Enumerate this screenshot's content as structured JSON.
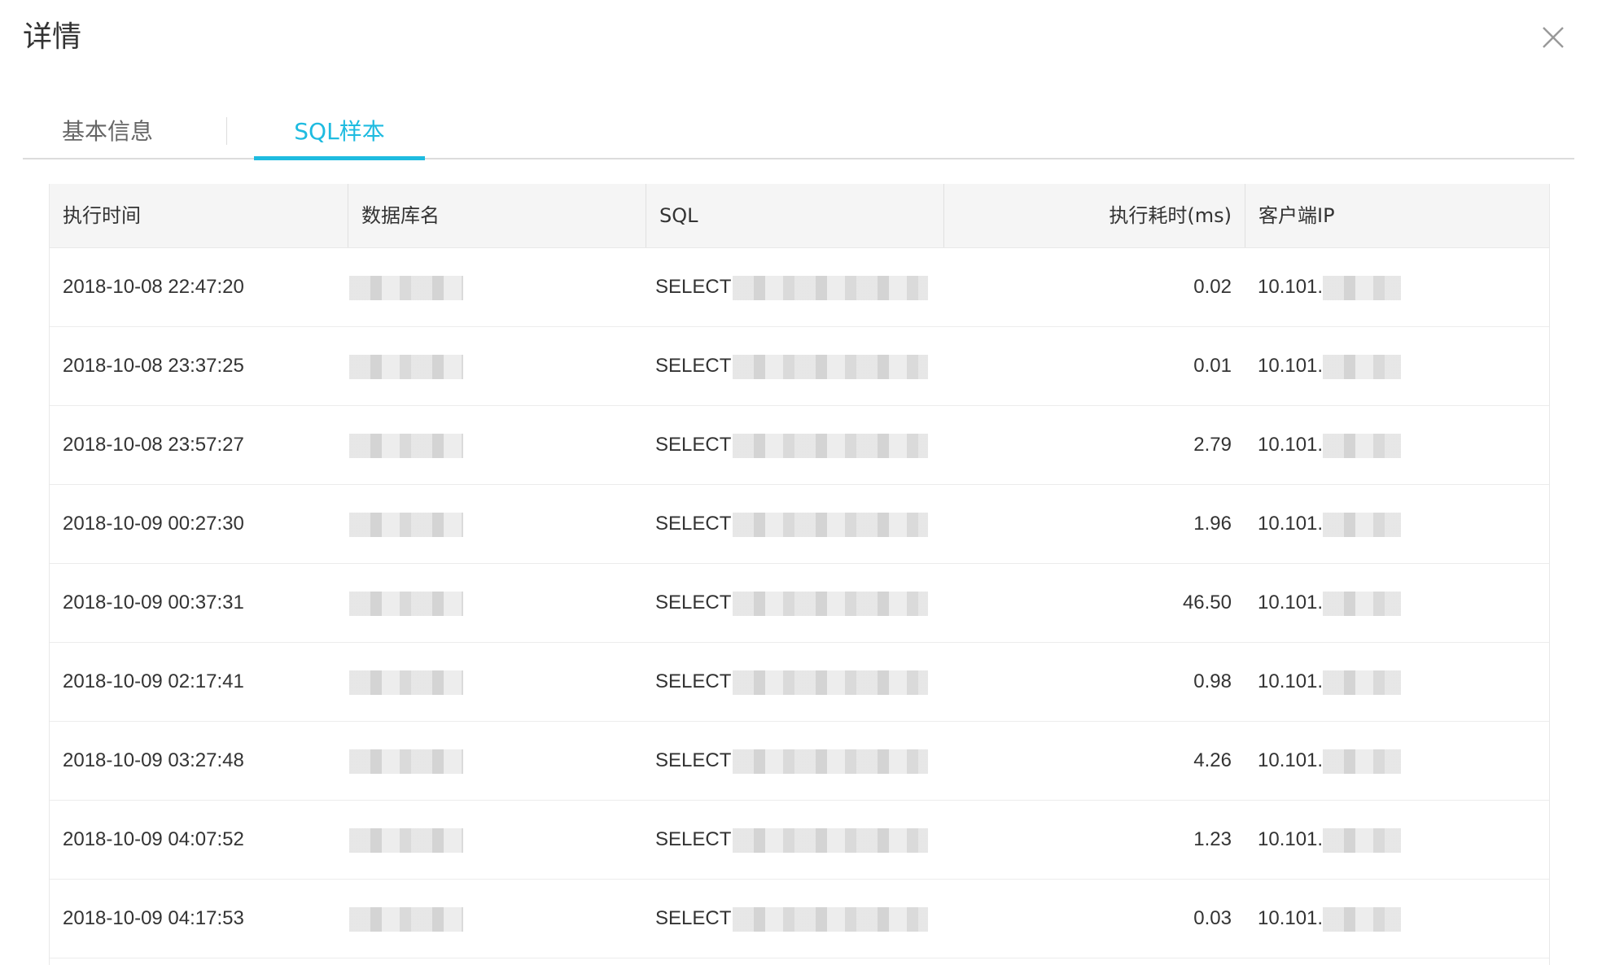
{
  "dialog": {
    "title": "详情"
  },
  "tabs": [
    {
      "label": "基本信息",
      "active": false
    },
    {
      "label": "SQL样本",
      "active": true
    }
  ],
  "colors": {
    "accent": "#1ebbe0",
    "header_bg": "#f5f5f5",
    "text": "#333333"
  },
  "icons": {
    "close": "close-icon"
  },
  "table": {
    "columns": [
      "执行时间",
      "数据库名",
      "SQL",
      "执行耗时(ms)",
      "客户端IP"
    ],
    "rows": [
      {
        "time": "2018-10-08 22:47:20",
        "sql": "SELECT",
        "duration": "0.02",
        "ip": "10.101."
      },
      {
        "time": "2018-10-08 23:37:25",
        "sql": "SELECT",
        "duration": "0.01",
        "ip": "10.101."
      },
      {
        "time": "2018-10-08 23:57:27",
        "sql": "SELECT",
        "duration": "2.79",
        "ip": "10.101."
      },
      {
        "time": "2018-10-09 00:27:30",
        "sql": "SELECT",
        "duration": "1.96",
        "ip": "10.101."
      },
      {
        "time": "2018-10-09 00:37:31",
        "sql": "SELECT",
        "duration": "46.50",
        "ip": "10.101."
      },
      {
        "time": "2018-10-09 02:17:41",
        "sql": "SELECT",
        "duration": "0.98",
        "ip": "10.101."
      },
      {
        "time": "2018-10-09 03:27:48",
        "sql": "SELECT",
        "duration": "4.26",
        "ip": "10.101."
      },
      {
        "time": "2018-10-09 04:07:52",
        "sql": "SELECT",
        "duration": "1.23",
        "ip": "10.101."
      },
      {
        "time": "2018-10-09 04:17:53",
        "sql": "SELECT",
        "duration": "0.03",
        "ip": "10.101."
      }
    ]
  }
}
